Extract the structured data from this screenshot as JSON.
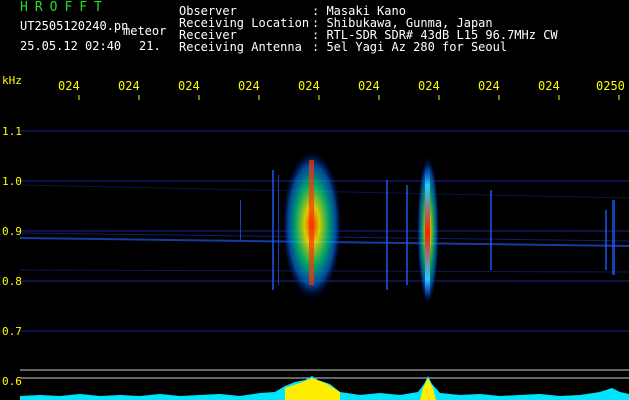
{
  "header": {
    "brand": "HROFFT",
    "filename": "UT2505120240.pn",
    "tag": "meteor",
    "datetime": "25.05.12 02:40",
    "extra": "21.",
    "fields": [
      {
        "label": "Observer",
        "value": ": Masaki Kano"
      },
      {
        "label": "Receiving Location",
        "value": ": Shibukawa, Gunma, Japan"
      },
      {
        "label": "Receiver",
        "value": ": RTL-SDR SDR# 43dB L15 96.7MHz CW"
      },
      {
        "label": "Receiving Antenna",
        "value": ": 5el Yagi Az 280 for Seoul"
      }
    ]
  },
  "axis": {
    "unit": "kHz",
    "yticks": [
      "1.1",
      "1.0",
      "0.9",
      "0.8",
      "0.7",
      "0.6"
    ],
    "minute_labels": [
      "024",
      "024",
      "024",
      "024",
      "024",
      "024",
      "024",
      "024",
      "024",
      "0250"
    ]
  },
  "colors": {
    "background": "#000000",
    "grid": "#2b2bb8",
    "text": "#ffffff",
    "brand": "#22dd22",
    "labels": "#ffff00",
    "level_trace": "#00ffff"
  }
}
